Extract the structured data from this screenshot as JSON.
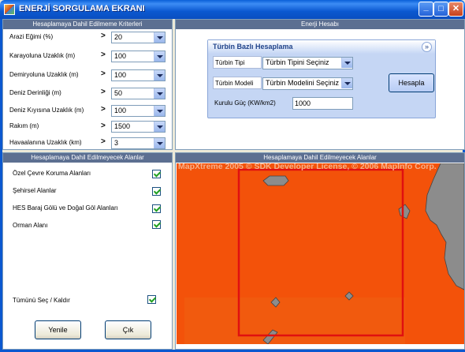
{
  "window": {
    "title": "ENERJİ SORGULAMA EKRANI",
    "minimize_glyph": "_",
    "maximize_glyph": "□",
    "close_glyph": "✕"
  },
  "criteria_panel": {
    "header": "Hesaplamaya Dahil Edilmeme Kriterleri",
    "rows": [
      {
        "label": "Arazi Eğimi (%)",
        "value": "20"
      },
      {
        "label": "Karayoluna Uzaklık (m)",
        "value": "100"
      },
      {
        "label": "Demiryoluna Uzaklık (m)",
        "value": "100"
      },
      {
        "label": "Deniz Derinliği (m)",
        "value": "50"
      },
      {
        "label": "Deniz Kıyısına Uzaklık (m)",
        "value": "100"
      },
      {
        "label": "Rakım (m)",
        "value": "1500"
      },
      {
        "label": "Havaalanına Uzaklık (km)",
        "value": "3"
      }
    ],
    "arrow": ">"
  },
  "energy_panel": {
    "header": "Enerji Hesabı",
    "group_title": "Türbin Bazlı Hesaplama",
    "collapse_glyph": "»",
    "turbine_type_label": "Türbin Tipi",
    "turbine_type_value": "Türbin Tipini Seçiniz",
    "turbine_model_label": "Türbin Modeli",
    "turbine_model_value": "Türbin Modelini Seçiniz",
    "installed_power_label": "Kurulu Güç (KW/km2)",
    "installed_power_value": "1000",
    "calculate_button": "Hesapla"
  },
  "excluded_areas_panel": {
    "header": "Hesaplamaya Dahil Edilmeyecek Alanlar",
    "items": [
      {
        "label": "Özel Çevre Koruma Alanları",
        "checked": true
      },
      {
        "label": "Şehirsel Alanlar",
        "checked": true
      },
      {
        "label": "HES Baraj Gölü ve Doğal Göl Alanları",
        "checked": true
      },
      {
        "label": "Orman Alanı",
        "checked": true
      }
    ],
    "select_all_label": "Tümünü Seç / Kaldır",
    "select_all_checked": true,
    "new_button": "Yenile",
    "exit_button": "Çık"
  },
  "map_panel": {
    "header": "Hesaplamaya Dahil Edilmeyecek Alanlar",
    "watermark": "MapXtreme 2005 © SDK Developer License, © 2006 MapInfo Corp.",
    "colors": {
      "fill": "#f3520a",
      "selection": "#e01010",
      "land": "#8c8c8c"
    }
  }
}
